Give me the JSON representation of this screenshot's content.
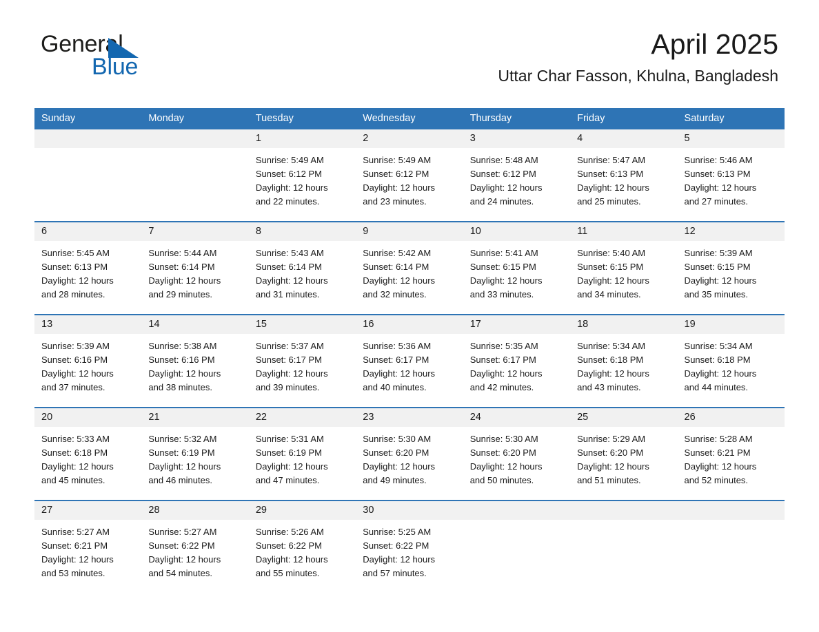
{
  "brand": {
    "name_part1": "General",
    "name_part2": "Blue",
    "accent_color": "#1367b0",
    "logo_icon": "triangle-flag-icon"
  },
  "header": {
    "month_title": "April 2025",
    "location": "Uttar Char Fasson, Khulna, Bangladesh"
  },
  "calendar": {
    "header_color": "#2e74b5",
    "daynum_band_color": "#f1f1f1",
    "weekdays": [
      "Sunday",
      "Monday",
      "Tuesday",
      "Wednesday",
      "Thursday",
      "Friday",
      "Saturday"
    ],
    "weeks": [
      [
        {
          "day": "",
          "empty": true,
          "sunrise": "",
          "sunset": "",
          "daylight1": "",
          "daylight2": ""
        },
        {
          "day": "",
          "empty": true,
          "sunrise": "",
          "sunset": "",
          "daylight1": "",
          "daylight2": ""
        },
        {
          "day": "1",
          "empty": false,
          "sunrise": "Sunrise: 5:49 AM",
          "sunset": "Sunset: 6:12 PM",
          "daylight1": "Daylight: 12 hours",
          "daylight2": "and 22 minutes."
        },
        {
          "day": "2",
          "empty": false,
          "sunrise": "Sunrise: 5:49 AM",
          "sunset": "Sunset: 6:12 PM",
          "daylight1": "Daylight: 12 hours",
          "daylight2": "and 23 minutes."
        },
        {
          "day": "3",
          "empty": false,
          "sunrise": "Sunrise: 5:48 AM",
          "sunset": "Sunset: 6:12 PM",
          "daylight1": "Daylight: 12 hours",
          "daylight2": "and 24 minutes."
        },
        {
          "day": "4",
          "empty": false,
          "sunrise": "Sunrise: 5:47 AM",
          "sunset": "Sunset: 6:13 PM",
          "daylight1": "Daylight: 12 hours",
          "daylight2": "and 25 minutes."
        },
        {
          "day": "5",
          "empty": false,
          "sunrise": "Sunrise: 5:46 AM",
          "sunset": "Sunset: 6:13 PM",
          "daylight1": "Daylight: 12 hours",
          "daylight2": "and 27 minutes."
        }
      ],
      [
        {
          "day": "6",
          "empty": false,
          "sunrise": "Sunrise: 5:45 AM",
          "sunset": "Sunset: 6:13 PM",
          "daylight1": "Daylight: 12 hours",
          "daylight2": "and 28 minutes."
        },
        {
          "day": "7",
          "empty": false,
          "sunrise": "Sunrise: 5:44 AM",
          "sunset": "Sunset: 6:14 PM",
          "daylight1": "Daylight: 12 hours",
          "daylight2": "and 29 minutes."
        },
        {
          "day": "8",
          "empty": false,
          "sunrise": "Sunrise: 5:43 AM",
          "sunset": "Sunset: 6:14 PM",
          "daylight1": "Daylight: 12 hours",
          "daylight2": "and 31 minutes."
        },
        {
          "day": "9",
          "empty": false,
          "sunrise": "Sunrise: 5:42 AM",
          "sunset": "Sunset: 6:14 PM",
          "daylight1": "Daylight: 12 hours",
          "daylight2": "and 32 minutes."
        },
        {
          "day": "10",
          "empty": false,
          "sunrise": "Sunrise: 5:41 AM",
          "sunset": "Sunset: 6:15 PM",
          "daylight1": "Daylight: 12 hours",
          "daylight2": "and 33 minutes."
        },
        {
          "day": "11",
          "empty": false,
          "sunrise": "Sunrise: 5:40 AM",
          "sunset": "Sunset: 6:15 PM",
          "daylight1": "Daylight: 12 hours",
          "daylight2": "and 34 minutes."
        },
        {
          "day": "12",
          "empty": false,
          "sunrise": "Sunrise: 5:39 AM",
          "sunset": "Sunset: 6:15 PM",
          "daylight1": "Daylight: 12 hours",
          "daylight2": "and 35 minutes."
        }
      ],
      [
        {
          "day": "13",
          "empty": false,
          "sunrise": "Sunrise: 5:39 AM",
          "sunset": "Sunset: 6:16 PM",
          "daylight1": "Daylight: 12 hours",
          "daylight2": "and 37 minutes."
        },
        {
          "day": "14",
          "empty": false,
          "sunrise": "Sunrise: 5:38 AM",
          "sunset": "Sunset: 6:16 PM",
          "daylight1": "Daylight: 12 hours",
          "daylight2": "and 38 minutes."
        },
        {
          "day": "15",
          "empty": false,
          "sunrise": "Sunrise: 5:37 AM",
          "sunset": "Sunset: 6:17 PM",
          "daylight1": "Daylight: 12 hours",
          "daylight2": "and 39 minutes."
        },
        {
          "day": "16",
          "empty": false,
          "sunrise": "Sunrise: 5:36 AM",
          "sunset": "Sunset: 6:17 PM",
          "daylight1": "Daylight: 12 hours",
          "daylight2": "and 40 minutes."
        },
        {
          "day": "17",
          "empty": false,
          "sunrise": "Sunrise: 5:35 AM",
          "sunset": "Sunset: 6:17 PM",
          "daylight1": "Daylight: 12 hours",
          "daylight2": "and 42 minutes."
        },
        {
          "day": "18",
          "empty": false,
          "sunrise": "Sunrise: 5:34 AM",
          "sunset": "Sunset: 6:18 PM",
          "daylight1": "Daylight: 12 hours",
          "daylight2": "and 43 minutes."
        },
        {
          "day": "19",
          "empty": false,
          "sunrise": "Sunrise: 5:34 AM",
          "sunset": "Sunset: 6:18 PM",
          "daylight1": "Daylight: 12 hours",
          "daylight2": "and 44 minutes."
        }
      ],
      [
        {
          "day": "20",
          "empty": false,
          "sunrise": "Sunrise: 5:33 AM",
          "sunset": "Sunset: 6:18 PM",
          "daylight1": "Daylight: 12 hours",
          "daylight2": "and 45 minutes."
        },
        {
          "day": "21",
          "empty": false,
          "sunrise": "Sunrise: 5:32 AM",
          "sunset": "Sunset: 6:19 PM",
          "daylight1": "Daylight: 12 hours",
          "daylight2": "and 46 minutes."
        },
        {
          "day": "22",
          "empty": false,
          "sunrise": "Sunrise: 5:31 AM",
          "sunset": "Sunset: 6:19 PM",
          "daylight1": "Daylight: 12 hours",
          "daylight2": "and 47 minutes."
        },
        {
          "day": "23",
          "empty": false,
          "sunrise": "Sunrise: 5:30 AM",
          "sunset": "Sunset: 6:20 PM",
          "daylight1": "Daylight: 12 hours",
          "daylight2": "and 49 minutes."
        },
        {
          "day": "24",
          "empty": false,
          "sunrise": "Sunrise: 5:30 AM",
          "sunset": "Sunset: 6:20 PM",
          "daylight1": "Daylight: 12 hours",
          "daylight2": "and 50 minutes."
        },
        {
          "day": "25",
          "empty": false,
          "sunrise": "Sunrise: 5:29 AM",
          "sunset": "Sunset: 6:20 PM",
          "daylight1": "Daylight: 12 hours",
          "daylight2": "and 51 minutes."
        },
        {
          "day": "26",
          "empty": false,
          "sunrise": "Sunrise: 5:28 AM",
          "sunset": "Sunset: 6:21 PM",
          "daylight1": "Daylight: 12 hours",
          "daylight2": "and 52 minutes."
        }
      ],
      [
        {
          "day": "27",
          "empty": false,
          "sunrise": "Sunrise: 5:27 AM",
          "sunset": "Sunset: 6:21 PM",
          "daylight1": "Daylight: 12 hours",
          "daylight2": "and 53 minutes."
        },
        {
          "day": "28",
          "empty": false,
          "sunrise": "Sunrise: 5:27 AM",
          "sunset": "Sunset: 6:22 PM",
          "daylight1": "Daylight: 12 hours",
          "daylight2": "and 54 minutes."
        },
        {
          "day": "29",
          "empty": false,
          "sunrise": "Sunrise: 5:26 AM",
          "sunset": "Sunset: 6:22 PM",
          "daylight1": "Daylight: 12 hours",
          "daylight2": "and 55 minutes."
        },
        {
          "day": "30",
          "empty": false,
          "sunrise": "Sunrise: 5:25 AM",
          "sunset": "Sunset: 6:22 PM",
          "daylight1": "Daylight: 12 hours",
          "daylight2": "and 57 minutes."
        },
        {
          "day": "",
          "empty": true,
          "sunrise": "",
          "sunset": "",
          "daylight1": "",
          "daylight2": ""
        },
        {
          "day": "",
          "empty": true,
          "sunrise": "",
          "sunset": "",
          "daylight1": "",
          "daylight2": ""
        },
        {
          "day": "",
          "empty": true,
          "sunrise": "",
          "sunset": "",
          "daylight1": "",
          "daylight2": ""
        }
      ]
    ]
  }
}
